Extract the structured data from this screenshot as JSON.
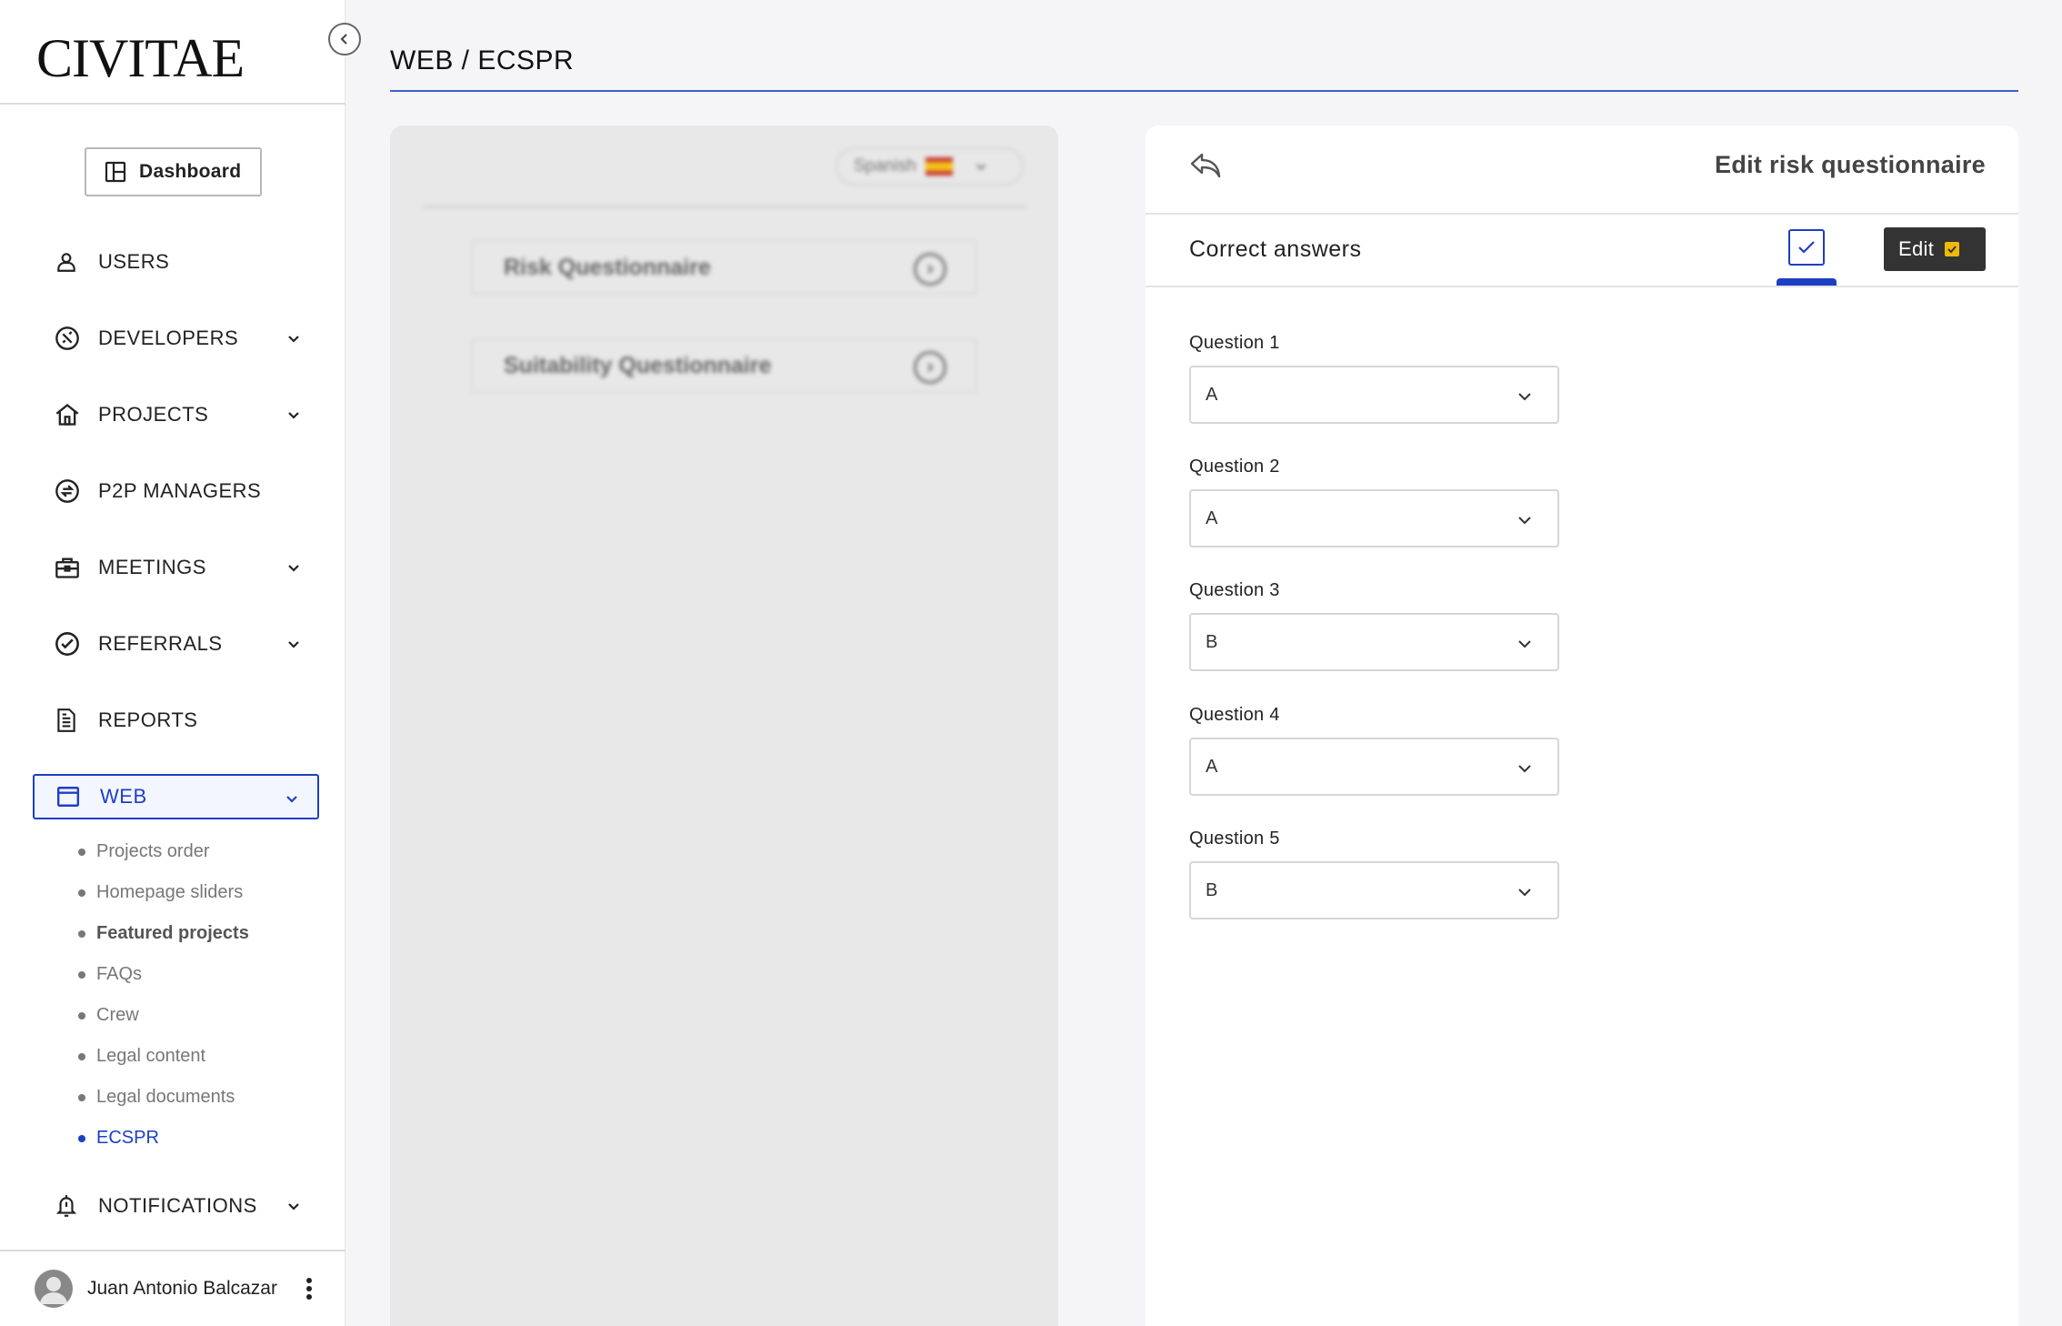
{
  "app": {
    "logo": "CIVITAE"
  },
  "sidebar": {
    "dashboard_label": "Dashboard",
    "items": [
      {
        "label": "USERS",
        "icon": "user-icon",
        "expandable": false
      },
      {
        "label": "DEVELOPERS",
        "icon": "developer-icon",
        "expandable": true
      },
      {
        "label": "PROJECTS",
        "icon": "home-icon",
        "expandable": true
      },
      {
        "label": "P2P MANAGERS",
        "icon": "exchange-icon",
        "expandable": false
      },
      {
        "label": "MEETINGS",
        "icon": "briefcase-icon",
        "expandable": true
      },
      {
        "label": "REFERRALS",
        "icon": "check-circle-icon",
        "expandable": true
      },
      {
        "label": "REPORTS",
        "icon": "document-icon",
        "expandable": false
      },
      {
        "label": "WEB",
        "icon": "window-icon",
        "expandable": true,
        "active": true
      },
      {
        "label": "NOTIFICATIONS",
        "icon": "bell-icon",
        "expandable": true
      }
    ],
    "web_subitems": [
      {
        "label": "Projects order"
      },
      {
        "label": "Homepage sliders"
      },
      {
        "label": "Featured projects"
      },
      {
        "label": "FAQs"
      },
      {
        "label": "Crew"
      },
      {
        "label": "Legal content"
      },
      {
        "label": "Legal documents"
      },
      {
        "label": "ECSPR",
        "active": true
      }
    ],
    "user_name": "Juan Antonio Balcazar"
  },
  "header": {
    "title": "WEB / ECSPR"
  },
  "left_panel": {
    "language": "Spanish",
    "cards": [
      {
        "label": "Risk Questionnaire"
      },
      {
        "label": "Suitability Questionnaire"
      }
    ]
  },
  "right_panel": {
    "title": "Edit risk questionnaire",
    "section_label": "Correct answers",
    "edit_label": "Edit",
    "questions": [
      {
        "label": "Question 1",
        "value": "A"
      },
      {
        "label": "Question 2",
        "value": "A"
      },
      {
        "label": "Question 3",
        "value": "B"
      },
      {
        "label": "Question 4",
        "value": "A"
      },
      {
        "label": "Question 5",
        "value": "B"
      }
    ]
  },
  "colors": {
    "accent": "#1d3fc4",
    "edit_button": "#333333",
    "edit_mark": "#f0b90b"
  }
}
